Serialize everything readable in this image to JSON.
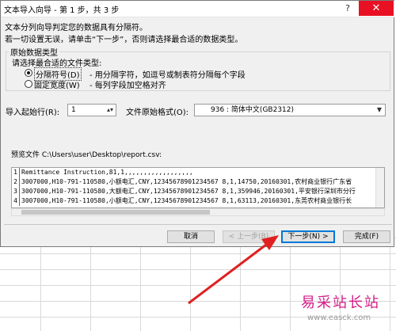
{
  "dialog": {
    "title": "文本导入向导 - 第 1 步，共 3 步",
    "help": "?",
    "close": "✕",
    "intro1": "文本分列向导判定您的数据具有分隔符。",
    "intro2": "若一切设置无误，请单击“下一步”，否则请选择最合适的数据类型。",
    "group_title": "原始数据类型",
    "group_prompt": "请选择最合适的文件类型:",
    "radio_delimited": "分隔符号(D)",
    "radio_delimited_desc": "- 用分隔字符，如逗号或制表符分隔每个字段",
    "radio_fixed": "固定宽度(W)",
    "radio_fixed_desc": "- 每列字段加空格对齐",
    "start_row_label": "导入起始行(R):",
    "start_row_value": "1",
    "origin_label": "文件原始格式(O):",
    "origin_value": "936 : 简体中文(GB2312)",
    "preview_label": "预览文件 C:\\Users\\user\\Desktop\\report.csv:",
    "preview_rows": [
      {
        "num": "1",
        "text": "Remittance Instruction,81,1,,,,,,,,,,,,,,,,,,"
      },
      {
        "num": "2",
        "text": "3007000,H10-791-110580,小额电汇,CNY,12345678901234567 8,1,14750,20160301,农村商业银行广东省"
      },
      {
        "num": "3",
        "text": "3007000,H10-791-110580,大额电汇,CNY,12345678901234567 8,1,359946,20160301,平安银行深圳市分行"
      },
      {
        "num": "4",
        "text": "3007000,H10-791-110580,小额电汇,CNY,12345678901234567 8,1,63113,20160301,东莞农村商业银行长"
      }
    ],
    "buttons": {
      "cancel": "取消",
      "prev": "< 上一步(B)",
      "next": "下一步(N) >",
      "finish": "完成(F)"
    }
  },
  "watermark": {
    "brand": "易采站长站",
    "url": "www.easck.com"
  },
  "colors": {
    "arrow": "#e02020",
    "close": "#e81123",
    "focus": "#0078d7"
  }
}
